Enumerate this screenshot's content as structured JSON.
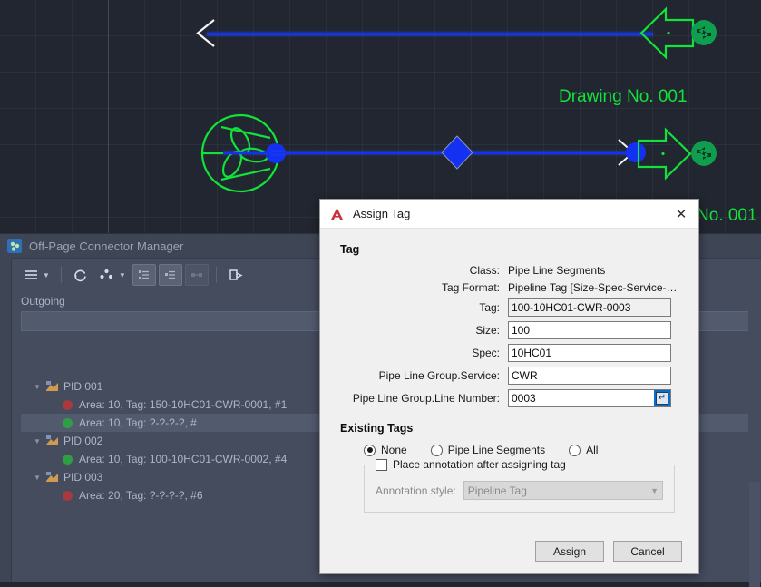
{
  "canvas": {
    "labels": [
      {
        "name": "drawing-no-top",
        "text": "Drawing No. 001"
      },
      {
        "name": "drawing-no-bottom",
        "text": "No. 001"
      }
    ],
    "colors": {
      "background": "#212630",
      "pipe": "#1430f0",
      "symbol_green": "#12e23a",
      "label_green": "#12e23a"
    }
  },
  "panel": {
    "title": "Off-Page Connector Manager",
    "section_label": "Outgoing",
    "search_value": "",
    "toolbar": [
      {
        "name": "menu-button",
        "icon": "hamburger-icon",
        "has_caret": true,
        "state": "normal"
      },
      {
        "name": "refresh-button",
        "icon": "refresh-icon",
        "has_caret": false,
        "state": "normal"
      },
      {
        "name": "node-options-button",
        "icon": "nodes-icon",
        "has_caret": true,
        "state": "normal"
      },
      {
        "name": "tree-view-button-1",
        "icon": "tree-expand-icon",
        "has_caret": false,
        "state": "active"
      },
      {
        "name": "tree-view-button-2",
        "icon": "tree-collapse-icon",
        "has_caret": false,
        "state": "active"
      },
      {
        "name": "tree-view-button-3",
        "icon": "tree-link-icon",
        "has_caret": false,
        "state": "disabled"
      },
      {
        "name": "export-button",
        "icon": "export-icon",
        "has_caret": false,
        "state": "normal"
      }
    ],
    "tree": [
      {
        "type": "group",
        "label": "PID 001"
      },
      {
        "type": "item",
        "status": "red",
        "label": "Area: 10, Tag: 150-10HC01-CWR-0001, #1",
        "selected": false
      },
      {
        "type": "item",
        "status": "green",
        "label": "Area: 10, Tag: ?-?-?-?, #",
        "selected": true
      },
      {
        "type": "group",
        "label": "PID 002"
      },
      {
        "type": "item",
        "status": "green",
        "label": "Area: 10, Tag: 100-10HC01-CWR-0002, #4",
        "selected": false
      },
      {
        "type": "group",
        "label": "PID 003"
      },
      {
        "type": "item",
        "status": "red",
        "label": "Area: 20, Tag: ?-?-?-?, #6",
        "selected": false
      }
    ]
  },
  "dialog": {
    "title": "Assign Tag",
    "close_label": "✕",
    "tag_group_title": "Tag",
    "fields": {
      "class_label": "Class:",
      "class_value": "Pipe Line Segments",
      "tag_format_label": "Tag Format:",
      "tag_format_value": "Pipeline Tag [Size-Spec-Service-…",
      "tag_label": "Tag:",
      "tag_value": "100-10HC01-CWR-0003",
      "size_label": "Size:",
      "size_value": "100",
      "spec_label": "Spec:",
      "spec_value": "10HC01",
      "service_label": "Pipe Line Group.Service:",
      "service_value": "CWR",
      "line_number_label": "Pipe Line Group.Line Number:",
      "line_number_value": "0003",
      "line_number_button_glyph": "↵"
    },
    "existing_tags": {
      "title": "Existing Tags",
      "options": [
        {
          "label": "None",
          "selected": true
        },
        {
          "label": "Pipe Line Segments",
          "selected": false
        },
        {
          "label": "All",
          "selected": false
        }
      ],
      "checkbox_label": "Place annotation after assigning tag",
      "checkbox_checked": false,
      "annotation_style_label": "Annotation style:",
      "annotation_style_value": "Pipeline Tag",
      "annotation_style_caret": "▼"
    },
    "buttons": {
      "assign": "Assign",
      "cancel": "Cancel"
    }
  }
}
